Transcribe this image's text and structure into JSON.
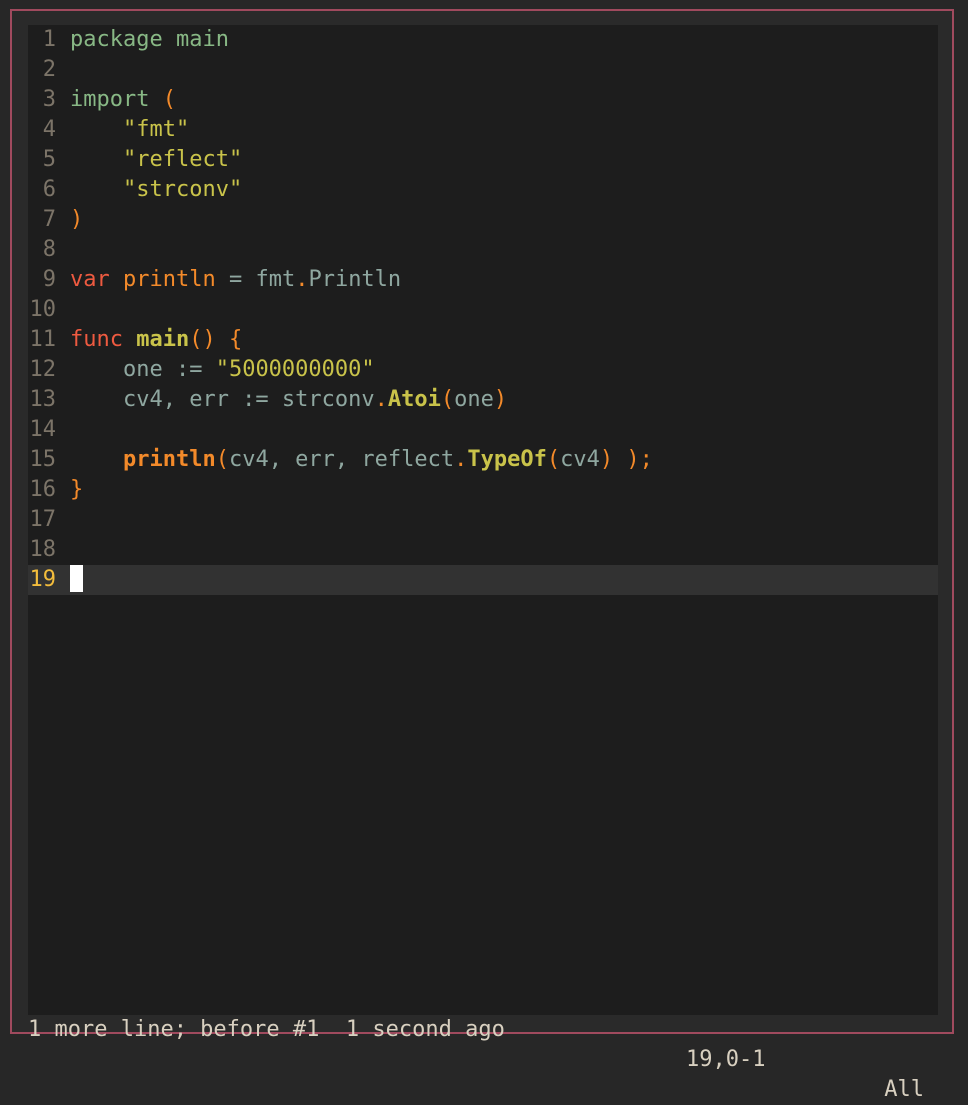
{
  "editor": {
    "lines": [
      {
        "n": "1",
        "tokens": [
          {
            "t": "package ",
            "c": "t-kw"
          },
          {
            "t": "main",
            "c": "t-kw"
          }
        ]
      },
      {
        "n": "2",
        "tokens": []
      },
      {
        "n": "3",
        "tokens": [
          {
            "t": "import ",
            "c": "t-kw"
          },
          {
            "t": "(",
            "c": "t-orange"
          }
        ]
      },
      {
        "n": "4",
        "tokens": [
          {
            "t": "    \"fmt\"",
            "c": "t-str"
          }
        ]
      },
      {
        "n": "5",
        "tokens": [
          {
            "t": "    \"reflect\"",
            "c": "t-str"
          }
        ]
      },
      {
        "n": "6",
        "tokens": [
          {
            "t": "    \"strconv\"",
            "c": "t-str"
          }
        ]
      },
      {
        "n": "7",
        "tokens": [
          {
            "t": ")",
            "c": "t-orange"
          }
        ]
      },
      {
        "n": "8",
        "tokens": []
      },
      {
        "n": "9",
        "tokens": [
          {
            "t": "var ",
            "c": "t-red"
          },
          {
            "t": "println",
            "c": "t-orange"
          },
          {
            "t": " = ",
            "c": "t-id"
          },
          {
            "t": "fmt",
            "c": "t-id"
          },
          {
            "t": ".",
            "c": "t-orange"
          },
          {
            "t": "Println",
            "c": "t-id"
          }
        ]
      },
      {
        "n": "10",
        "tokens": []
      },
      {
        "n": "11",
        "tokens": [
          {
            "t": "func ",
            "c": "t-red"
          },
          {
            "t": "main",
            "c": "t-fn"
          },
          {
            "t": "() {",
            "c": "t-orange"
          }
        ]
      },
      {
        "n": "12",
        "tokens": [
          {
            "t": "    one := ",
            "c": "t-id"
          },
          {
            "t": "\"5000000000\"",
            "c": "t-str"
          }
        ]
      },
      {
        "n": "13",
        "tokens": [
          {
            "t": "    cv4, err := strconv",
            "c": "t-id"
          },
          {
            "t": ".",
            "c": "t-orange"
          },
          {
            "t": "Atoi",
            "c": "t-fn"
          },
          {
            "t": "(",
            "c": "t-orange"
          },
          {
            "t": "one",
            "c": "t-id"
          },
          {
            "t": ")",
            "c": "t-orange"
          }
        ]
      },
      {
        "n": "14",
        "tokens": []
      },
      {
        "n": "15",
        "tokens": [
          {
            "t": "    ",
            "c": "t-id"
          },
          {
            "t": "println",
            "c": "t-call"
          },
          {
            "t": "(",
            "c": "t-orange"
          },
          {
            "t": "cv4, err, reflect",
            "c": "t-id"
          },
          {
            "t": ".",
            "c": "t-orange"
          },
          {
            "t": "TypeOf",
            "c": "t-fn"
          },
          {
            "t": "(",
            "c": "t-orange"
          },
          {
            "t": "cv4",
            "c": "t-id"
          },
          {
            "t": ") );",
            "c": "t-orange"
          }
        ]
      },
      {
        "n": "16",
        "tokens": [
          {
            "t": "}",
            "c": "t-orange"
          }
        ]
      },
      {
        "n": "17",
        "tokens": []
      },
      {
        "n": "18",
        "tokens": []
      },
      {
        "n": "19",
        "tokens": [],
        "current": true
      }
    ]
  },
  "status": {
    "message": "1 more line; before #1  1 second ago",
    "position": "19,0-1",
    "scroll": "All"
  },
  "colors": {
    "border": "#a04a5e",
    "background": "#1d1d1d",
    "current_line": "#323232",
    "current_line_number": "#f3bd3c"
  }
}
